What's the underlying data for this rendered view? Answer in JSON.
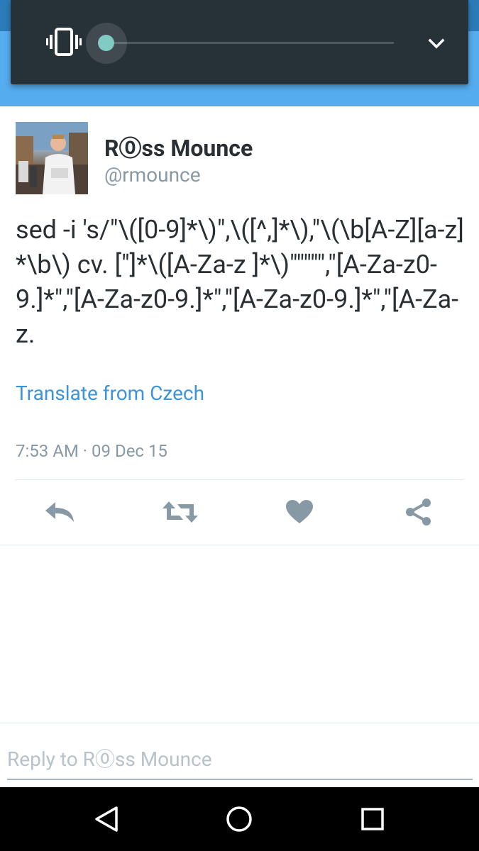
{
  "volume_panel": {
    "level": 0.0,
    "mode_icon": "vibrate-icon",
    "expand_icon": "chevron-down-icon"
  },
  "tweet": {
    "author_name": "R⓪ss Mounce",
    "author_handle": "@rmounce",
    "text": "sed -i 's/\"\\([0-9]*\\)\",\\([^,]*\\),\"\\(\\b[A-Z][a-z]*\\b\\) cv. [\"]*\\([A-Za-z ]*\\)\"\"\"\"\",\"[A-Za-z0-9.]*\",\"[A-Za-z0-9.]*\",\"[A-Za-z0-9.]*\",\"[A-Za-z.",
    "translate_label": "Translate from Czech",
    "timestamp": "7:53 AM · 09 Dec 15"
  },
  "actions": [
    {
      "name": "reply",
      "icon": "reply-icon"
    },
    {
      "name": "retweet",
      "icon": "retweet-icon"
    },
    {
      "name": "like",
      "icon": "heart-icon"
    },
    {
      "name": "share",
      "icon": "share-icon"
    }
  ],
  "reply": {
    "placeholder": "Reply to R⓪ss Mounce"
  },
  "navbar": {
    "buttons": [
      "back-icon",
      "home-icon",
      "recents-icon"
    ]
  },
  "colors": {
    "brand_blue": "#55acee",
    "link_blue": "#3b94d9",
    "icon_gray": "#8899a6",
    "slider_accent": "#80cbc4"
  }
}
